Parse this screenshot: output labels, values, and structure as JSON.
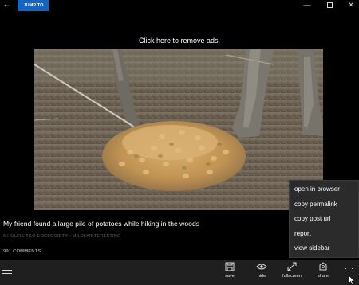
{
  "titlebar": {
    "back_icon": "back-arrow-icon",
    "jump_label": "JUMP TO",
    "jump_color": "#1565c0",
    "controls": [
      "minimize-icon",
      "maximize-icon",
      "close-icon"
    ]
  },
  "ads": {
    "text": "Click here to remove ads."
  },
  "post": {
    "image_alt": "Pile of potatoes on forest floor",
    "title": "My friend found a large pile of potatoes while hiking in the woods",
    "time": "6 HOURS AGO",
    "author": "EOCSOCIETY",
    "separator": "•",
    "subreddit": "MILDLYINTERESTING",
    "comments": "991 COMMENTS"
  },
  "appbar": {
    "menu_icon": "hamburger-icon",
    "buttons": [
      {
        "label": "save",
        "icon": "save-icon"
      },
      {
        "label": "hide",
        "icon": "eye-icon"
      },
      {
        "label": "fullscreen",
        "icon": "expand-icon"
      },
      {
        "label": "share",
        "icon": "share-icon"
      }
    ],
    "more": "···",
    "background": "#1f1f1f"
  },
  "context_menu": {
    "items": [
      "open in browser",
      "copy permalink",
      "copy post url",
      "report",
      "view sidebar"
    ],
    "background": "#2b2b2b"
  }
}
